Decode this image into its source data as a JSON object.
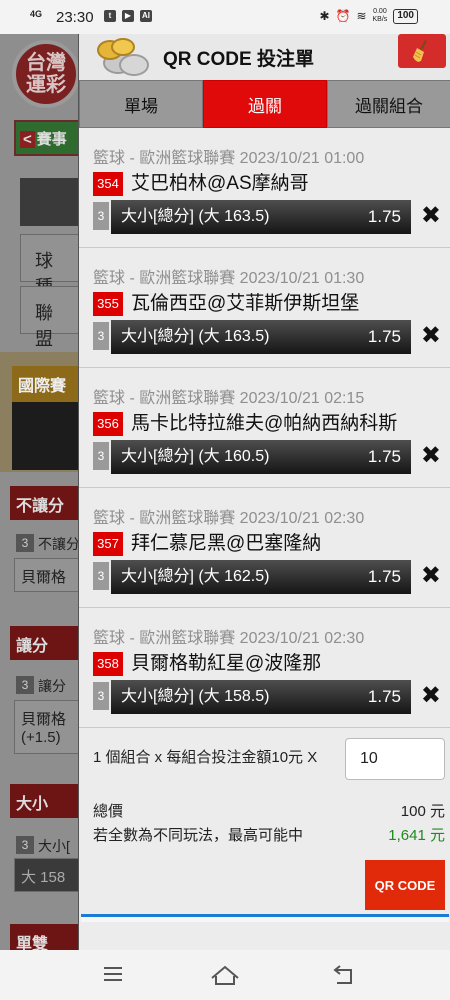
{
  "status_bar": {
    "network": "4G",
    "time": "23:30",
    "speed_value": "0.00",
    "speed_unit": "KB/s",
    "battery": "100"
  },
  "background": {
    "logo_line1": "台灣",
    "logo_line2": "運彩",
    "tab_label": "賽事",
    "ball_type": "球種",
    "league": "聯盟",
    "intl": "國際賽",
    "no_handicap_header": "不讓分",
    "no_handicap_row": "不讓分",
    "no_handicap_sel": "貝爾格",
    "handicap_header": "讓分",
    "handicap_row": "讓分",
    "handicap_sel": "貝爾格",
    "handicap_sel2": "(+1.5)",
    "ou_header": "大小",
    "ou_row": "大小[",
    "ou_sel": "大 158",
    "oddeven_header": "單雙"
  },
  "modal": {
    "title": "QR CODE 投注單",
    "tabs": [
      {
        "label": "單場",
        "active": false
      },
      {
        "label": "過關",
        "active": true
      },
      {
        "label": "過關組合",
        "active": false
      }
    ],
    "bets": [
      {
        "league": "籃球 - 歐洲籃球聯賽 2023/10/21 01:00",
        "num": "354",
        "match": "艾巴柏林@AS摩納哥",
        "q": "3",
        "market": "大小[總分] (大 163.5)",
        "odds": "1.75"
      },
      {
        "league": "籃球 - 歐洲籃球聯賽 2023/10/21 01:30",
        "num": "355",
        "match": "瓦倫西亞@艾菲斯伊斯坦堡",
        "q": "3",
        "market": "大小[總分] (大 163.5)",
        "odds": "1.75"
      },
      {
        "league": "籃球 - 歐洲籃球聯賽 2023/10/21 02:15",
        "num": "356",
        "match": "馬卡比特拉維夫@帕納西納科斯",
        "q": "3",
        "market": "大小[總分] (大 160.5)",
        "odds": "1.75"
      },
      {
        "league": "籃球 - 歐洲籃球聯賽 2023/10/21 02:30",
        "num": "357",
        "match": "拜仁慕尼黑@巴塞隆納",
        "q": "3",
        "market": "大小[總分] (大 162.5)",
        "odds": "1.75"
      },
      {
        "league": "籃球 - 歐洲籃球聯賽 2023/10/21 02:30",
        "num": "358",
        "match": "貝爾格勒紅星@波隆那",
        "q": "3",
        "market": "大小[總分] (大 158.5)",
        "odds": "1.75"
      }
    ],
    "summary": {
      "combo_text": "1 個組合 x 每組合投注金額10元 X",
      "amount_value": "10",
      "total_label": "總價",
      "total_value": "100 元",
      "max_label": "若全數為不同玩法，最高可能中",
      "max_value": "1,641 元",
      "qr_button": "QR CODE"
    }
  },
  "colors": {
    "accent_red": "#e10a0a",
    "win_green": "#1f8a1f"
  }
}
